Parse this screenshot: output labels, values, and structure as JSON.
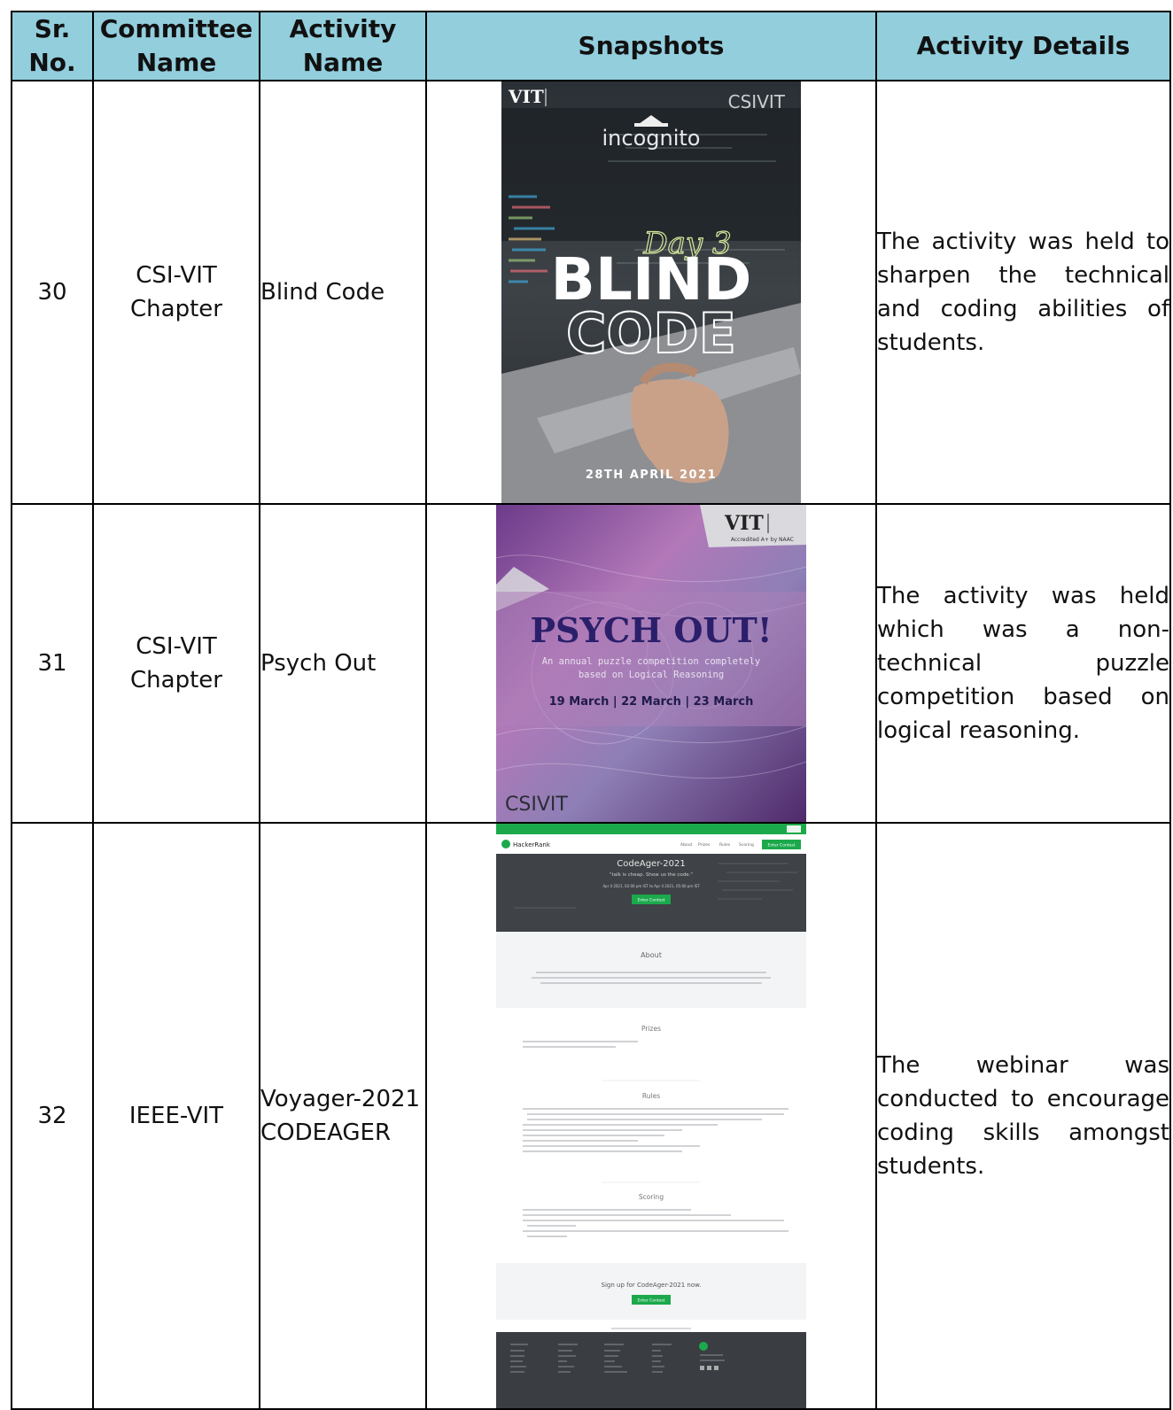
{
  "table": {
    "headers": {
      "sr_no": "Sr. No.",
      "committee": "Committee Name",
      "activity": "Activity Name",
      "snapshots": "Snapshots",
      "details": "Activity Details"
    },
    "rows": [
      {
        "sr_no": "30",
        "committee": "CSI-VIT Chapter",
        "activity": "Blind Code",
        "details": "The activity was held to sharpen the technical and coding abilities of students.",
        "poster": {
          "logo": "VIT",
          "brand": "CSIVIT",
          "title": "incognito",
          "day": "Day 3",
          "headline1": "BLIND",
          "headline2": "CODE",
          "date": "28TH APRIL 2021"
        }
      },
      {
        "sr_no": "31",
        "committee": "CSI-VIT Chapter",
        "activity": "Psych Out",
        "details": "The activity was held which was a non-technical puzzle competition based on logical reasoning.",
        "poster": {
          "logo": "VIT",
          "accredit": "Accredited A+ by NAAC",
          "headline": "PSYCH OUT!",
          "tagline1": "An annual puzzle competition completely",
          "tagline2": "based on Logical Reasoning",
          "dates": "19 March | 22 March | 23 March",
          "brand": "CSIVIT"
        }
      },
      {
        "sr_no": "32",
        "committee": "IEEE-VIT",
        "activity": "Voyager-2021 CODEAGER",
        "details": "The webinar was conducted to encourage coding skills amongst students.",
        "poster": {
          "brand": "HackerRank",
          "nav": [
            "About",
            "Prizes",
            "Rules",
            "Scoring"
          ],
          "nav_button": "Enter Contest",
          "title": "CodeAger-2021",
          "quote": "\"talk is cheap. Show us the code.\"",
          "when": "Apr 4 2021, 02:00 pm IST to Apr 4 2021, 05:00 pm IST",
          "enter": "Enter Contest",
          "about": "About",
          "prizes": "Prizes",
          "rules": "Rules",
          "scoring": "Scoring",
          "signup": "Sign up for CodeAger-2021 now.",
          "signup_button": "Enter Contest"
        }
      }
    ]
  }
}
